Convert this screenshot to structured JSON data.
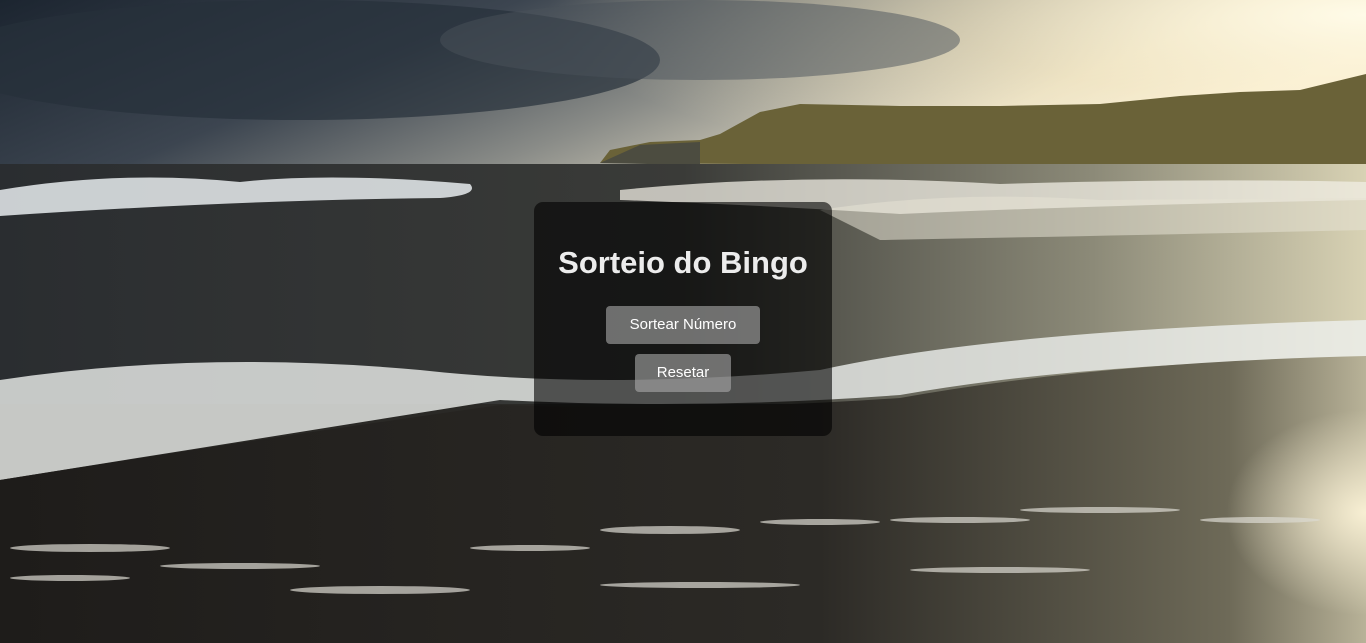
{
  "page": {
    "title": "Sorteio do Bingo"
  },
  "buttons": {
    "draw_label": "Sortear Número",
    "reset_label": "Resetar"
  }
}
